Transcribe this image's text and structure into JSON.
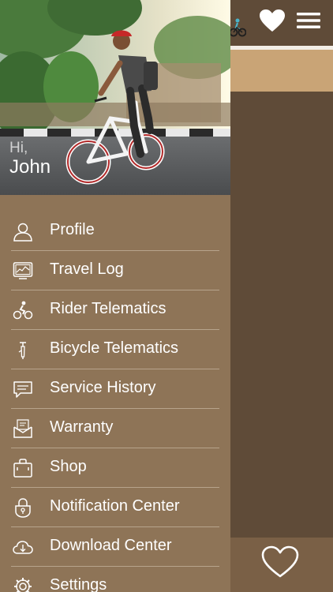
{
  "user": {
    "greeting": "Hi,",
    "name": "John"
  },
  "menu": {
    "items": [
      {
        "label": "Profile",
        "icon": "person-icon"
      },
      {
        "label": "Travel Log",
        "icon": "travel-log-icon"
      },
      {
        "label": "Rider Telematics",
        "icon": "cyclist-icon"
      },
      {
        "label": "Bicycle Telematics",
        "icon": "bike-pump-icon"
      },
      {
        "label": "Service History",
        "icon": "chat-bubble-icon"
      },
      {
        "label": "Warranty",
        "icon": "envelope-icon"
      },
      {
        "label": "Shop",
        "icon": "shop-bag-icon"
      },
      {
        "label": "Notification Center",
        "icon": "lock-icon"
      },
      {
        "label": "Download Center",
        "icon": "cloud-download-icon"
      },
      {
        "label": "Settings",
        "icon": "gear-icon"
      }
    ]
  },
  "colors": {
    "drawer_bg": "#8e7457",
    "main_bg": "#5f4b38",
    "accent_strip": "#c9a476",
    "divider": "#b7a48c"
  }
}
